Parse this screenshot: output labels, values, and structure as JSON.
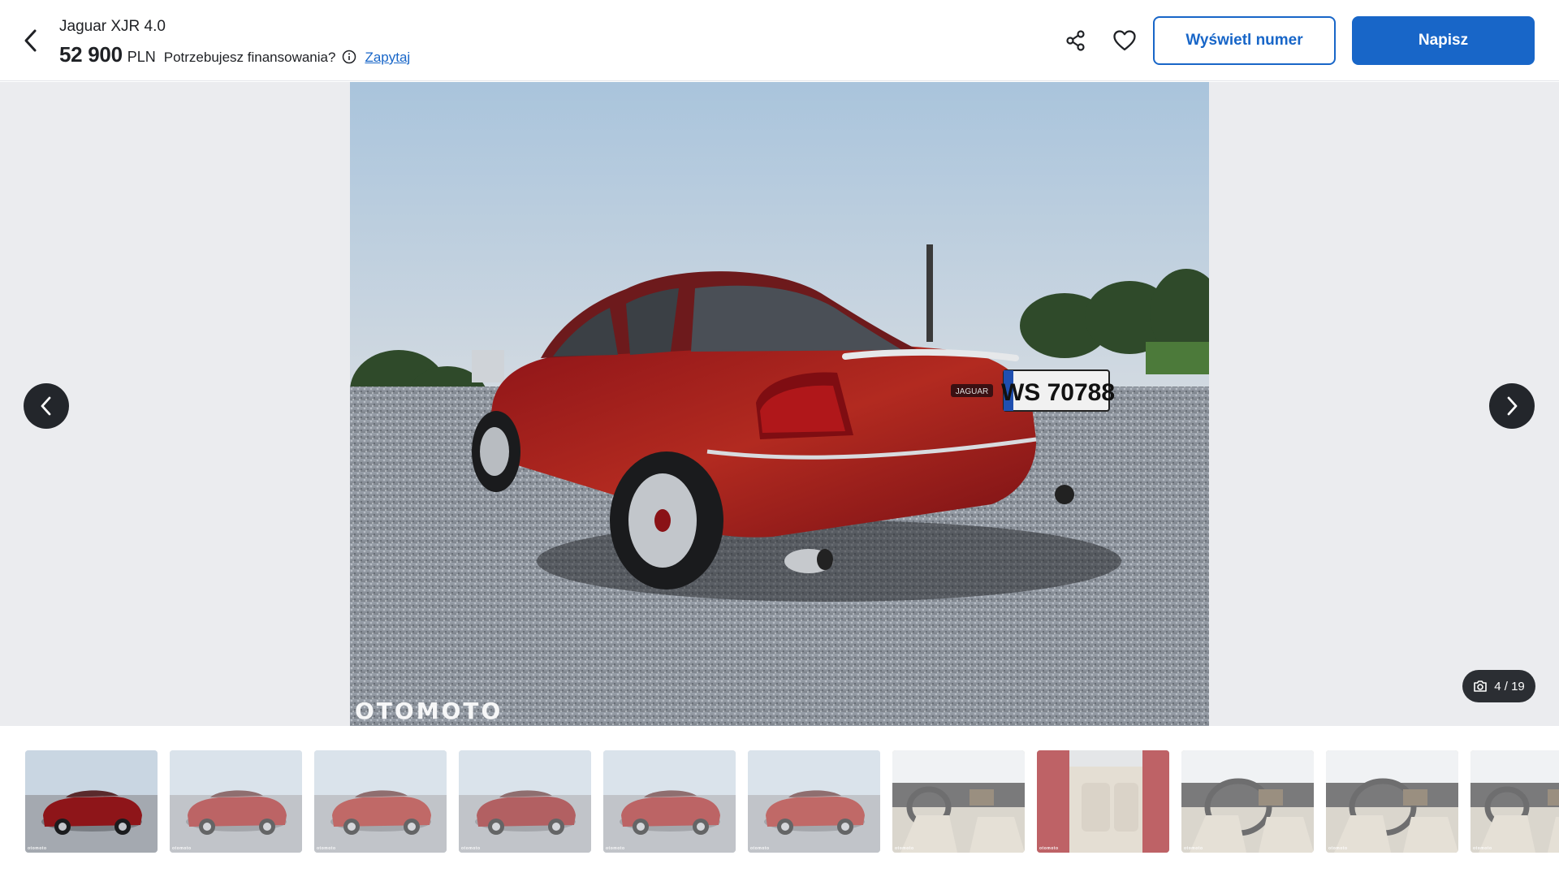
{
  "header": {
    "title": "Jaguar XJR 4.0",
    "price_value": "52 900",
    "price_currency": "PLN",
    "financing_question": "Potrzebujesz finansowania?",
    "financing_link": "Zapytaj",
    "show_number_label": "Wyświetl numer",
    "write_label": "Napisz",
    "accent_color": "#1866c8"
  },
  "gallery": {
    "watermark": "OTOMOTO",
    "plate_text": "WS 70788",
    "badge_text": "JAGUAR",
    "counter": "4 / 19",
    "icons": {
      "back": "chevron-left-icon",
      "share": "share-icon",
      "favorite": "heart-icon",
      "info": "info-icon",
      "prev": "chevron-left-icon",
      "next": "chevron-right-icon",
      "counter": "camera-icon"
    }
  },
  "thumbnails": {
    "watermark": "otomoto",
    "items": [
      {
        "scene": "rear-quarter",
        "active": true
      },
      {
        "scene": "rear"
      },
      {
        "scene": "side-rear"
      },
      {
        "scene": "side"
      },
      {
        "scene": "front-quarter"
      },
      {
        "scene": "front"
      },
      {
        "scene": "interior-front"
      },
      {
        "scene": "interior-door"
      },
      {
        "scene": "dashboard"
      },
      {
        "scene": "steering-wheel"
      },
      {
        "scene": "dashboard-partial"
      }
    ]
  }
}
